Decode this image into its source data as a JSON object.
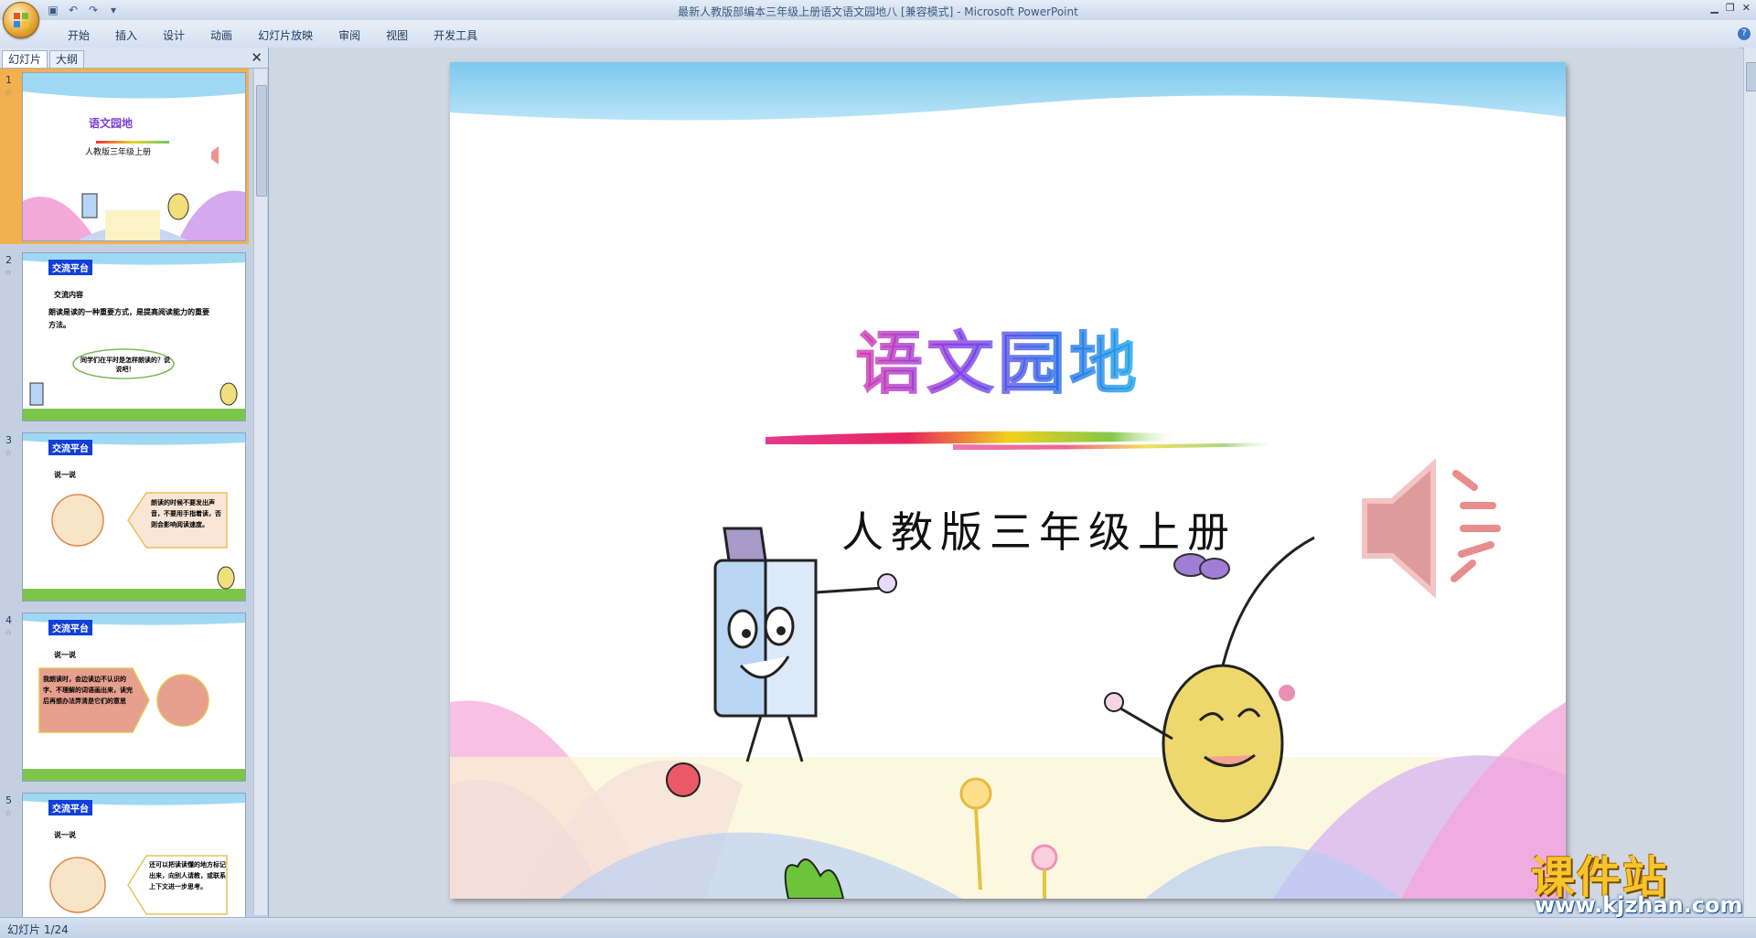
{
  "window": {
    "title": "最新人教版部编本三年级上册语文语文园地八 [兼容模式] - Microsoft PowerPoint"
  },
  "ribbon_tabs": [
    "开始",
    "插入",
    "设计",
    "动画",
    "幻灯片放映",
    "审阅",
    "视图",
    "开发工具"
  ],
  "left_pane": {
    "tabs": [
      "幻灯片",
      "大纲"
    ],
    "thumbnails": [
      {
        "num": "1",
        "title": "语文园地",
        "subtitle": "人教版三年级上册"
      },
      {
        "num": "2",
        "header": "交流平台",
        "section": "交流内容",
        "body": "朗读是读的一种重要方式，是提高阅读能力的重要方法。",
        "bubble": "同学们在平时是怎样朗读的？说说吧！"
      },
      {
        "num": "3",
        "header": "交流平台",
        "section": "说一说",
        "body": "朗读的时候不要发出声音，不要用手指着读，否则会影响阅读速度。"
      },
      {
        "num": "4",
        "header": "交流平台",
        "section": "说一说",
        "body": "我朗读时，会边读边不认识的字、不理解的词语画出来，读完后再想办法弄清是它们的意思"
      },
      {
        "num": "5",
        "header": "交流平台",
        "section": "说一说",
        "body": "还可以把读读懂的地方标记出来，向别人请教，或联系上下文进一步思考。"
      }
    ]
  },
  "slide": {
    "title": "语文园地",
    "subtitle": "人教版三年级上册"
  },
  "status": {
    "text": "幻灯片 1/24"
  },
  "watermark": {
    "brand": "课件站",
    "url": "www.kjzhan.com"
  },
  "colors": {
    "accent": "#f2b04e",
    "ribbon_bg": "#dbe4f1",
    "sky": "#8fd0f0"
  }
}
